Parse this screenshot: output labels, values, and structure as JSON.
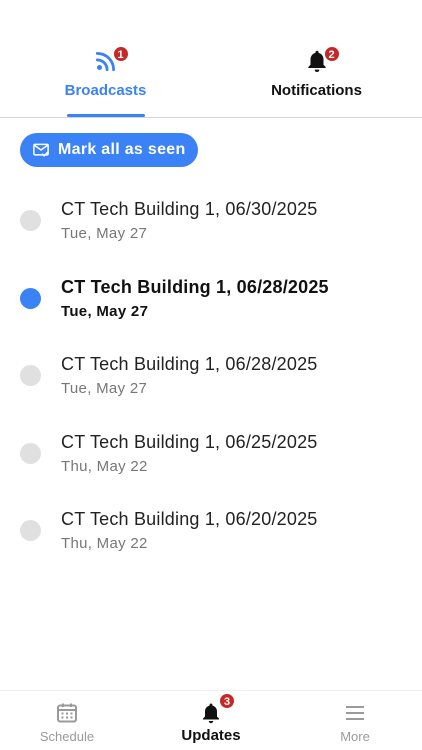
{
  "tabs": {
    "broadcasts": {
      "label": "Broadcasts",
      "badge": "1",
      "icon": "rss-icon"
    },
    "notifications": {
      "label": "Notifications",
      "badge": "2",
      "icon": "bell-icon"
    }
  },
  "actions": {
    "mark_all_label": "Mark all as seen"
  },
  "items": [
    {
      "title": "CT Tech Building 1, 06/30/2025",
      "date": "Tue, May 27",
      "unread": false
    },
    {
      "title": "CT Tech Building 1, 06/28/2025",
      "date": "Tue, May 27",
      "unread": true
    },
    {
      "title": "CT Tech Building 1, 06/28/2025",
      "date": "Tue, May 27",
      "unread": false
    },
    {
      "title": "CT Tech Building 1, 06/25/2025",
      "date": "Thu, May 22",
      "unread": false
    },
    {
      "title": "CT Tech Building 1, 06/20/2025",
      "date": "Thu, May 22",
      "unread": false
    }
  ],
  "bottom_nav": {
    "schedule": {
      "label": "Schedule",
      "icon": "calendar-icon"
    },
    "updates": {
      "label": "Updates",
      "badge": "3",
      "icon": "bell-icon"
    },
    "more": {
      "label": "More",
      "icon": "menu-icon"
    }
  },
  "colors": {
    "accent": "#3b82f6",
    "badge": "#c62828",
    "read_dot": "#e0e0e0"
  }
}
